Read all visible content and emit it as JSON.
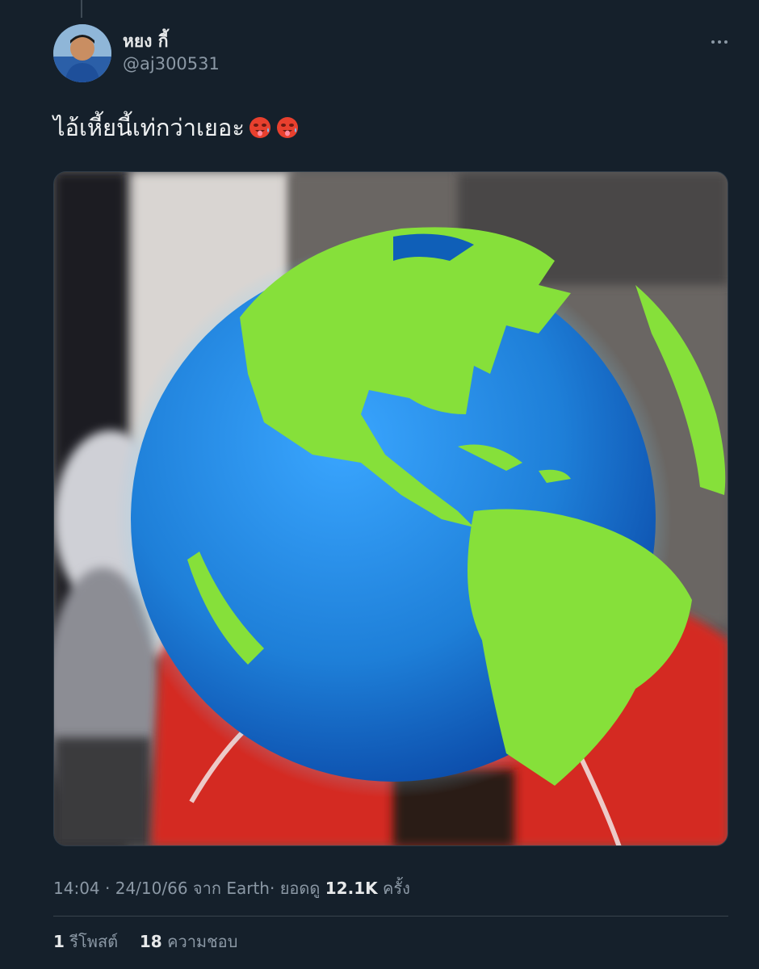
{
  "tweet": {
    "display_name": "หยง กี้",
    "handle": "@aj300531",
    "text": "ไอ้เหี้ยนี้เท่กว่าเยอะ",
    "emojis": [
      "hot-face-emoji",
      "hot-face-emoji"
    ],
    "time": "14:04",
    "date": "24/10/66",
    "via_prefix": "จาก",
    "source": "Earth",
    "views_label": "ยอดดู",
    "views_count": "12.1K",
    "views_suffix": "ครั้ง",
    "separator": "·"
  },
  "stats": {
    "retweets_count": "1",
    "retweets_label": "รีโพสต์",
    "likes_count": "18",
    "likes_label": "ความชอบ"
  },
  "media": {
    "description_icon": "globe-emoji",
    "globe_ocean": "#1e7fd8",
    "globe_land": "#86e03a",
    "shirt_color": "#d42a22"
  },
  "colors": {
    "background": "#15202b",
    "primary_text": "#e7e9ea",
    "secondary_text": "#8b98a5",
    "divider": "#38444d"
  }
}
